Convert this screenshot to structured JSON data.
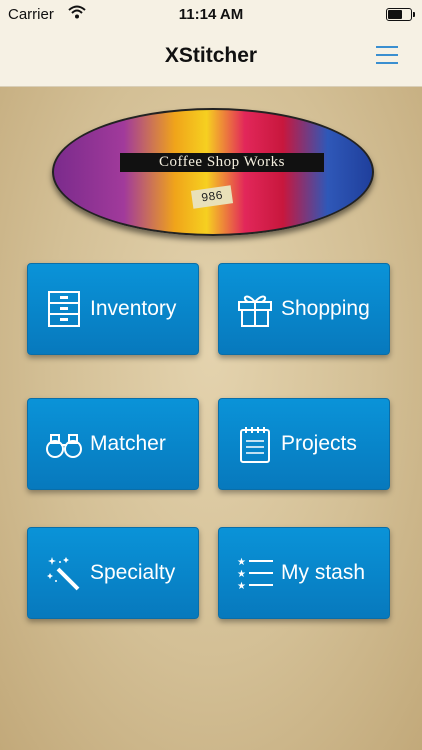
{
  "status": {
    "carrier": "Carrier",
    "time": "11:14 AM"
  },
  "nav": {
    "title": "XStitcher"
  },
  "banner": {
    "text": "Coffee Shop Works",
    "tag": "986"
  },
  "tiles": [
    {
      "label": "Inventory",
      "icon": "drawers-icon"
    },
    {
      "label": "Shopping",
      "icon": "gift-icon"
    },
    {
      "label": "Matcher",
      "icon": "binoculars-icon"
    },
    {
      "label": "Projects",
      "icon": "notepad-icon"
    },
    {
      "label": "Specialty",
      "icon": "magic-wand-icon"
    },
    {
      "label": "My stash",
      "icon": "starred-list-icon"
    }
  ],
  "colors": {
    "accent": "#3a8fd0",
    "tile": "#0a8ad0"
  }
}
